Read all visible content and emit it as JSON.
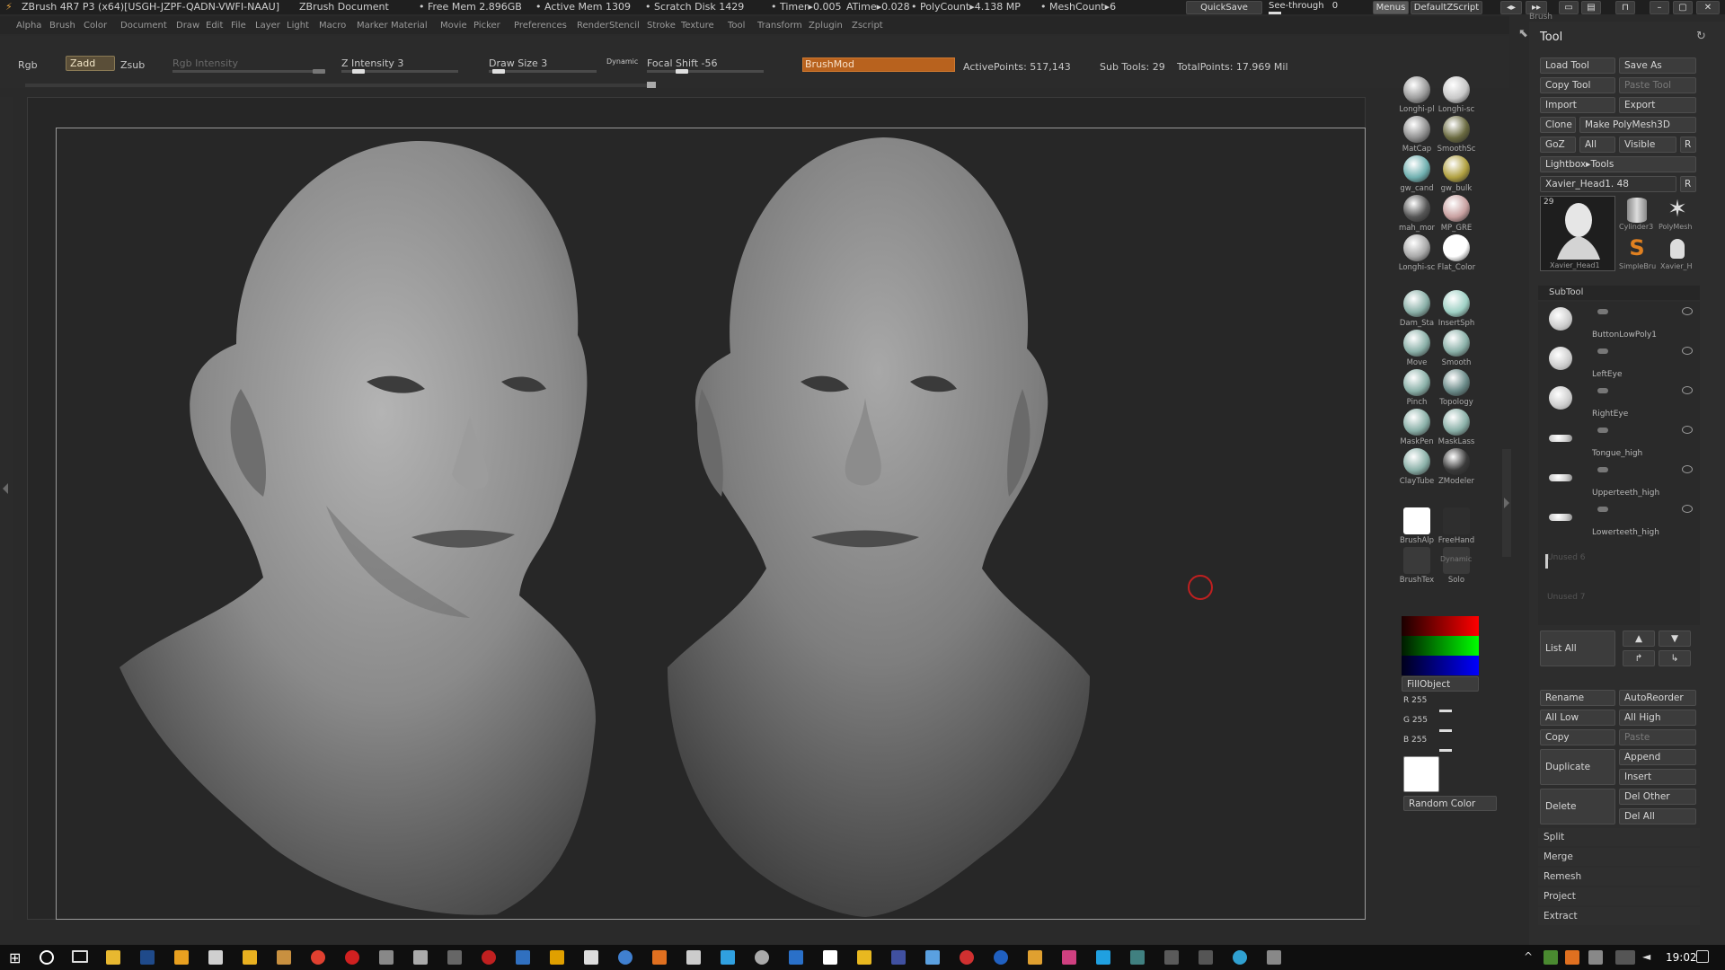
{
  "titlebar": {
    "app_title": "ZBrush 4R7 P3 (x64)[USGH-JZPF-QADN-VWFI-NAAU]",
    "document": "ZBrush Document",
    "free_mem": "• Free Mem 2.896GB",
    "active_mem": "• Active Mem 1309",
    "scratch_disk": "• Scratch Disk 1429",
    "timer": "• Timer▸0.005",
    "atime": "ATime▸0.028",
    "polycount": "• PolyCount▸4.138 MP",
    "meshcount": "• MeshCount▸6",
    "quicksave": "QuickSave",
    "seethrough": "See-through",
    "seethrough_value": "0",
    "menus": "Menus",
    "script": "DefaultZScript"
  },
  "menubar": {
    "items": [
      "Alpha",
      "Brush",
      "Color",
      "Document",
      "Draw",
      "Edit",
      "File",
      "Layer",
      "Light",
      "Macro",
      "Marker",
      "Material",
      "Movie",
      "Picker",
      "Preferences",
      "Render",
      "Stencil",
      "Stroke",
      "Texture",
      "Tool",
      "Transform",
      "Zplugin",
      "Zscript"
    ]
  },
  "shelf": {
    "rgb": "Rgb",
    "zadd": "Zadd",
    "zsub": "Zsub",
    "rgb_intensity": "Rgb Intensity",
    "z_intensity": "Z Intensity 3",
    "draw_size": "Draw Size 3",
    "dynamic": "Dynamic",
    "focal_shift": "Focal Shift -56",
    "brushmod": "BrushMod",
    "active_points": "ActivePoints: 517,143",
    "sub_tools": "Sub Tools: 29",
    "total_points": "TotalPoints: 17.969 Mil"
  },
  "brushes": [
    {
      "label": "Longhi-pl",
      "color": "#9a9a9a"
    },
    {
      "label": "Longhi-sc",
      "color": "#c7c7c7"
    },
    {
      "label": "MatCap",
      "color": "#8f8f8f"
    },
    {
      "label": "SmoothSc",
      "color": "#6a6a40"
    },
    {
      "label": "gw_cand",
      "color": "#70b0b0"
    },
    {
      "label": "gw_bulk",
      "color": "#b0a040"
    },
    {
      "label": "mah_mor",
      "color": "#555555"
    },
    {
      "label": "MP_GRE",
      "color": "#c8a0a0"
    },
    {
      "label": "Longhi-sc",
      "color": "#a8a8a8"
    },
    {
      "label": "Flat_Color",
      "color": "#ffffff"
    },
    {
      "label": "Dam_Sta",
      "color": "#8ab0a8"
    },
    {
      "label": "InsertSph",
      "color": "#9ed0c4"
    },
    {
      "label": "Move",
      "color": "#8ab0a8"
    },
    {
      "label": "Smooth",
      "color": "#8ab0a8"
    },
    {
      "label": "Pinch",
      "color": "#8ab0a8"
    },
    {
      "label": "Topology",
      "color": "#6a8a88"
    },
    {
      "label": "MaskPen",
      "color": "#8ab0a8"
    },
    {
      "label": "MaskLass",
      "color": "#8ab0a8"
    },
    {
      "label": "ClayTube",
      "color": "#8ab0a8"
    },
    {
      "label": "ZModeler",
      "color": "#3a3a3a"
    },
    {
      "label": "BrushAlp",
      "color": "#ffffff"
    },
    {
      "label": "FreeHand",
      "color": "#2e2e2e"
    },
    {
      "label": "BrushTex",
      "color": "#3a3a3a"
    },
    {
      "label": "Solo",
      "color": "#3a3a3a"
    }
  ],
  "solo_label": "Dynamic",
  "color": {
    "fillobject": "FillObject",
    "r": "R 255",
    "g": "G 255",
    "b": "B 255",
    "random_color": "Random Color",
    "swatch": "#ffffff"
  },
  "tool": {
    "title": "Tool",
    "brush_header": "Brush",
    "load_tool": "Load Tool",
    "save_as": "Save As",
    "copy_tool": "Copy Tool",
    "paste_tool": "Paste Tool",
    "import": "Import",
    "export": "Export",
    "clone": "Clone",
    "make_polymesh": "Make PolyMesh3D",
    "goz": "GoZ",
    "all": "All",
    "visible": "Visible",
    "r": "R",
    "lightbox_tools": "Lightbox▸Tools",
    "current_tool": "Xavier_Head1. 48",
    "thumb_count": "29",
    "thumbs": [
      {
        "label": "Xavier_Head1"
      },
      {
        "label": "Cylinder3"
      },
      {
        "label": "PolyMesh"
      },
      {
        "label": "SimpleBru"
      },
      {
        "label": "Xavier_H"
      }
    ],
    "subtool_header": "SubTool",
    "subtools": [
      {
        "name": "ButtonLowPoly1"
      },
      {
        "name": "LeftEye"
      },
      {
        "name": "RightEye"
      },
      {
        "name": "Tongue_high"
      },
      {
        "name": "Upperteeth_high"
      },
      {
        "name": "Lowerteeth_high"
      }
    ],
    "unused_6": "Unused 6",
    "unused_7": "Unused 7",
    "list_all": "List All",
    "rename": "Rename",
    "autoreorder": "AutoReorder",
    "all_low": "All Low",
    "all_high": "All High",
    "copy": "Copy",
    "paste": "Paste",
    "duplicate": "Duplicate",
    "append": "Append",
    "insert": "Insert",
    "delete": "Delete",
    "del_other": "Del Other",
    "del_all": "Del All",
    "split": "Split",
    "merge": "Merge",
    "remesh": "Remesh",
    "project": "Project",
    "extract": "Extract"
  },
  "taskbar": {
    "clock": "19:02"
  }
}
